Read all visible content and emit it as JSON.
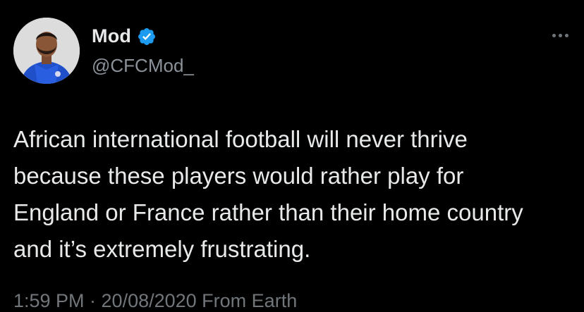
{
  "post": {
    "author": {
      "display_name": "Mod",
      "handle": "@CFCMod_",
      "verified": true,
      "avatar_icon": "profile-photo"
    },
    "more_icon": "more-horizontal-icon",
    "text": "African international football will never thrive\nbecause these players would rather play for\nEngland or France rather than their home country\nand it’s extremely frustrating.",
    "meta": "1:59 PM · 20/08/2020 From Earth"
  },
  "colors": {
    "background": "#000000",
    "text": "#e7e9ea",
    "secondary": "#71767b",
    "verified": "#1d9bf0"
  }
}
